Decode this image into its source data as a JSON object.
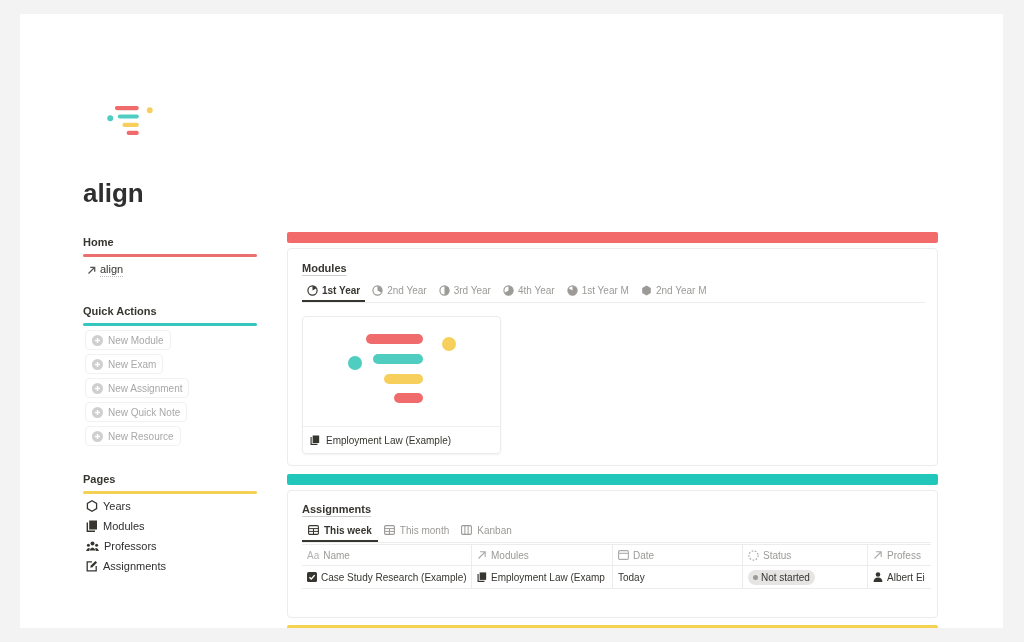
{
  "page": {
    "title": "align"
  },
  "sidebar": [
    {
      "kind": "links",
      "title": "Home",
      "color": "#ec6f6f",
      "items": [
        {
          "label": "align"
        }
      ]
    },
    {
      "kind": "actions",
      "title": "Quick Actions",
      "color": "#35c6bd",
      "items": [
        {
          "label": "New Module"
        },
        {
          "label": "New Exam"
        },
        {
          "label": "New Assignment"
        },
        {
          "label": "New Quick Note"
        },
        {
          "label": "New Resource"
        }
      ]
    },
    {
      "kind": "pages",
      "title": "Pages",
      "color": "#f4d154",
      "items": [
        {
          "label": "Years"
        },
        {
          "label": "Modules"
        },
        {
          "label": "Professors"
        },
        {
          "label": "Assignments"
        }
      ]
    }
  ],
  "sections": [
    {
      "kind": "gallery",
      "color": "#f26a6a",
      "title": "Modules",
      "tabs": [
        {
          "label": "1st Year",
          "selected": true
        },
        {
          "label": "2nd Year",
          "selected": false
        },
        {
          "label": "3rd Year",
          "selected": false
        },
        {
          "label": "4th Year",
          "selected": false
        },
        {
          "label": "1st Year M",
          "selected": false
        },
        {
          "label": "2nd Year M",
          "selected": false
        }
      ],
      "cards": [
        {
          "title": "Employment Law (Example)"
        }
      ]
    },
    {
      "kind": "table",
      "color": "#22c7bb",
      "title": "Assignments",
      "tabs": [
        {
          "kind": "table",
          "label": "This week",
          "selected": true
        },
        {
          "kind": "table",
          "label": "This month",
          "selected": false
        },
        {
          "kind": "board",
          "label": "Kanban",
          "selected": false
        }
      ],
      "columns": [
        {
          "kind": "title",
          "glyph": "Aa",
          "label": "Name"
        },
        {
          "kind": "relation",
          "label": "Modules"
        },
        {
          "kind": "date",
          "label": "Date"
        },
        {
          "kind": "status",
          "label": "Status"
        },
        {
          "kind": "relation",
          "label": "Profess"
        }
      ],
      "rows": [
        {
          "cells": [
            "Case Study Research (Example)",
            "Employment Law (Examp",
            "Today",
            "Not started",
            "Albert Ei"
          ]
        }
      ]
    },
    {
      "kind": "bar",
      "color": "#f5d250"
    }
  ]
}
